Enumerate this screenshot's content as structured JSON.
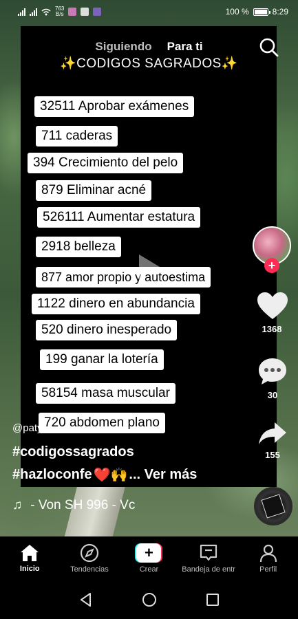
{
  "status_bar": {
    "speed_top": "763",
    "speed_bottom": "B/s",
    "battery": "100 %",
    "time": "8:29"
  },
  "top_tabs": {
    "following": "Siguiendo",
    "for_you": "Para ti"
  },
  "overlay": {
    "title_left": "✨",
    "title": "CODIGOS SAGRADOS",
    "title_right": "✨",
    "codes": [
      "32511 Aprobar exámenes",
      "711 caderas",
      "394 Crecimiento del pelo",
      "879 Eliminar acné",
      "526111 Aumentar estatura",
      "2918 belleza",
      "877 amor propio y autoestima",
      "1122 dinero en abundancia",
      "520 dinero inesperado",
      "199 ganar la lotería",
      "58154 masa muscular",
      "720 abdomen plano"
    ]
  },
  "rail": {
    "likes": "1368",
    "comments": "30",
    "shares": "155",
    "follow_plus": "+"
  },
  "caption": {
    "handle": "@paty",
    "hashtag1": "#codigossagrados",
    "hashtag2": "#hazloconfe",
    "hashtag2_emoji": "❤️🙌",
    "see_more": "... Ver más",
    "music_note": "♫",
    "music": "- Von    SH 996 - Vc"
  },
  "bottom_nav": [
    {
      "label": "Inicio",
      "icon": "home-icon"
    },
    {
      "label": "Tendencias",
      "icon": "compass-icon"
    },
    {
      "label": "Crear",
      "icon": "plus-icon"
    },
    {
      "label": "Bandeja de entr",
      "icon": "inbox-icon"
    },
    {
      "label": "Perfil",
      "icon": "profile-icon"
    }
  ],
  "colors": {
    "accent_red": "#fe2c55",
    "accent_cyan": "#25f4ee"
  }
}
